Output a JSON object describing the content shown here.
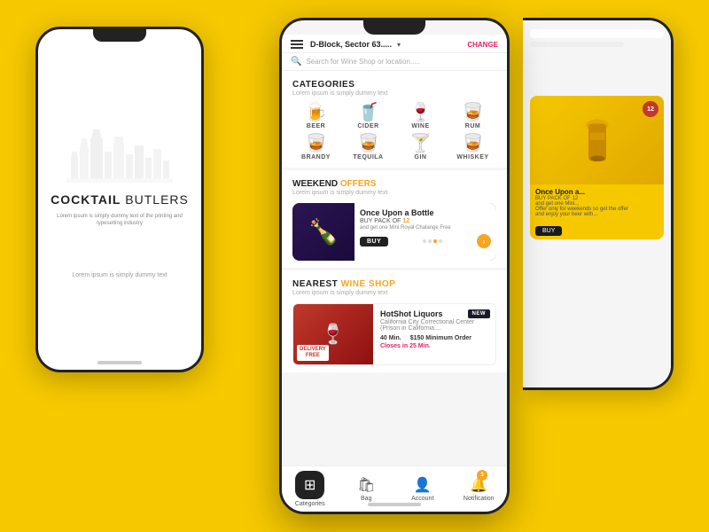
{
  "background_color": "#F5C800",
  "left_phone": {
    "brand": "COCKTAIL",
    "brand_light": " BUTLERS",
    "subtitle": "Lorem ipsum is simply dummy text of the printing and typesetting industry",
    "footer": "Lorem ipsum is simply dummy text"
  },
  "top_bar": {
    "location": "D-Block, Sector 63.....",
    "change_label": "CHANGE"
  },
  "search": {
    "placeholder": "Search for Wine Shop or location....."
  },
  "categories": {
    "title": "CATEGORIES",
    "subtitle": "Lorem ipsum is simply dummy text",
    "items": [
      {
        "label": "BEER",
        "icon": "🍺"
      },
      {
        "label": "CIDER",
        "icon": "🥤"
      },
      {
        "label": "WINE",
        "icon": "🍷"
      },
      {
        "label": "RUM",
        "icon": "🥃"
      },
      {
        "label": "BRANDY",
        "icon": "🥃"
      },
      {
        "label": "TEQUILA",
        "icon": "🥃"
      },
      {
        "label": "GIN",
        "icon": "🍸"
      },
      {
        "label": "WHISKEY",
        "icon": "🥃"
      }
    ]
  },
  "offers": {
    "title": "WEEKEND",
    "title_highlight": " OFFERS",
    "subtitle": "Lorem ipsum is simply dummy text",
    "card": {
      "title": "Once Upon a Bottle",
      "pack_label": "BUY PACK OF",
      "pack_number": "12",
      "free_text": "and get one Mini Royal Chalange Free",
      "offer_detail": "Offer only for weekends so get the offer end enjoy your beer with pizza",
      "buy_label": "BUY"
    }
  },
  "wine_shop": {
    "title": "NEAREST",
    "title_highlight": " WINE SHOP",
    "subtitle": "Lorem ipsum is simply dummy text",
    "card": {
      "name": "HotShot Liquors",
      "address": "California City Correctional Center (Prison in California....",
      "delivery_time": "40 Min.",
      "min_order": "$150 Minimum Order",
      "closes": "Closes in 25 Min.",
      "badge": "NEW",
      "delivery_free": "DELIVERY FREE"
    }
  },
  "bottom_nav": {
    "items": [
      {
        "label": "Categories",
        "icon": "⊞",
        "active": true
      },
      {
        "label": "Bag",
        "icon": "🛍",
        "active": false
      },
      {
        "label": "Account",
        "icon": "👤",
        "active": false
      },
      {
        "label": "Notification",
        "icon": "🔔",
        "active": false,
        "badge": "3"
      }
    ]
  }
}
